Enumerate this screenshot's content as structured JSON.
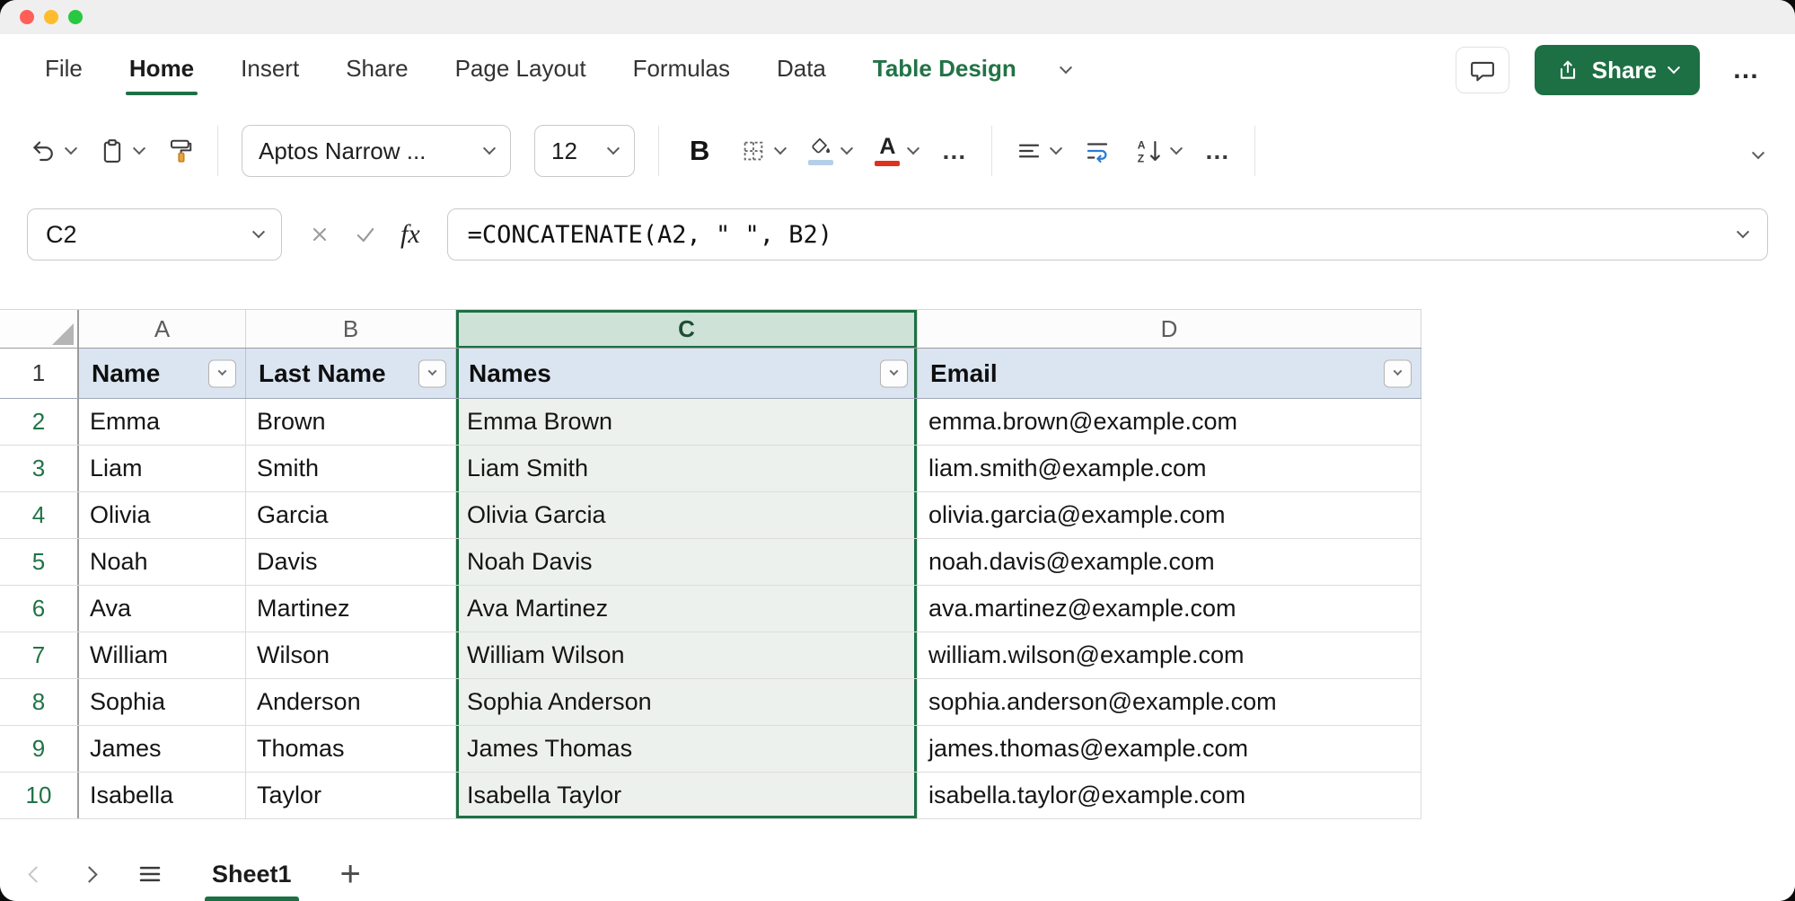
{
  "colors": {
    "accent_green": "#1d7044",
    "table_green": "#217346",
    "header_blue": "#dbe5f1",
    "selection_tint": "#edf1ed",
    "col_head_sel": "#cfe2d7",
    "font_color_red": "#e0301e",
    "traffic_red": "#ff5f57",
    "traffic_yellow": "#febc2e",
    "traffic_green": "#28c840"
  },
  "tabs": {
    "items": [
      {
        "label": "File"
      },
      {
        "label": "Home"
      },
      {
        "label": "Insert"
      },
      {
        "label": "Share"
      },
      {
        "label": "Page Layout"
      },
      {
        "label": "Formulas"
      },
      {
        "label": "Data"
      },
      {
        "label": "Table Design"
      }
    ],
    "active": "Home"
  },
  "actions": {
    "share_label": "Share",
    "more_label": "…"
  },
  "toolbar": {
    "font_name": "Aptos Narrow ...",
    "font_size": "12",
    "bold_label": "B",
    "font_color_letter": "A",
    "more_label": "…"
  },
  "formula_bar": {
    "name_box": "C2",
    "fx_label": "fx",
    "formula": "=CONCATENATE(A2, \" \", B2)"
  },
  "grid": {
    "column_letters": [
      "A",
      "B",
      "C",
      "D"
    ],
    "selected_column": "C",
    "header_row_num": "1",
    "headers": [
      "Name",
      "Last Name",
      "Names",
      "Email"
    ],
    "rows": [
      {
        "num": "2",
        "cells": [
          "Emma",
          "Brown",
          "Emma Brown",
          "emma.brown@example.com"
        ]
      },
      {
        "num": "3",
        "cells": [
          "Liam",
          "Smith",
          "Liam Smith",
          "liam.smith@example.com"
        ]
      },
      {
        "num": "4",
        "cells": [
          "Olivia",
          "Garcia",
          "Olivia Garcia",
          "olivia.garcia@example.com"
        ]
      },
      {
        "num": "5",
        "cells": [
          "Noah",
          "Davis",
          "Noah Davis",
          "noah.davis@example.com"
        ]
      },
      {
        "num": "6",
        "cells": [
          "Ava",
          "Martinez",
          "Ava Martinez",
          "ava.martinez@example.com"
        ]
      },
      {
        "num": "7",
        "cells": [
          "William",
          "Wilson",
          "William Wilson",
          "william.wilson@example.com"
        ]
      },
      {
        "num": "8",
        "cells": [
          "Sophia",
          "Anderson",
          "Sophia Anderson",
          "sophia.anderson@example.com"
        ]
      },
      {
        "num": "9",
        "cells": [
          "James",
          "Thomas",
          "James Thomas",
          "james.thomas@example.com"
        ]
      },
      {
        "num": "10",
        "cells": [
          "Isabella",
          "Taylor",
          "Isabella Taylor",
          "isabella.taylor@example.com"
        ]
      }
    ]
  },
  "sheet_bar": {
    "sheet_name": "Sheet1",
    "add_label": "+"
  }
}
